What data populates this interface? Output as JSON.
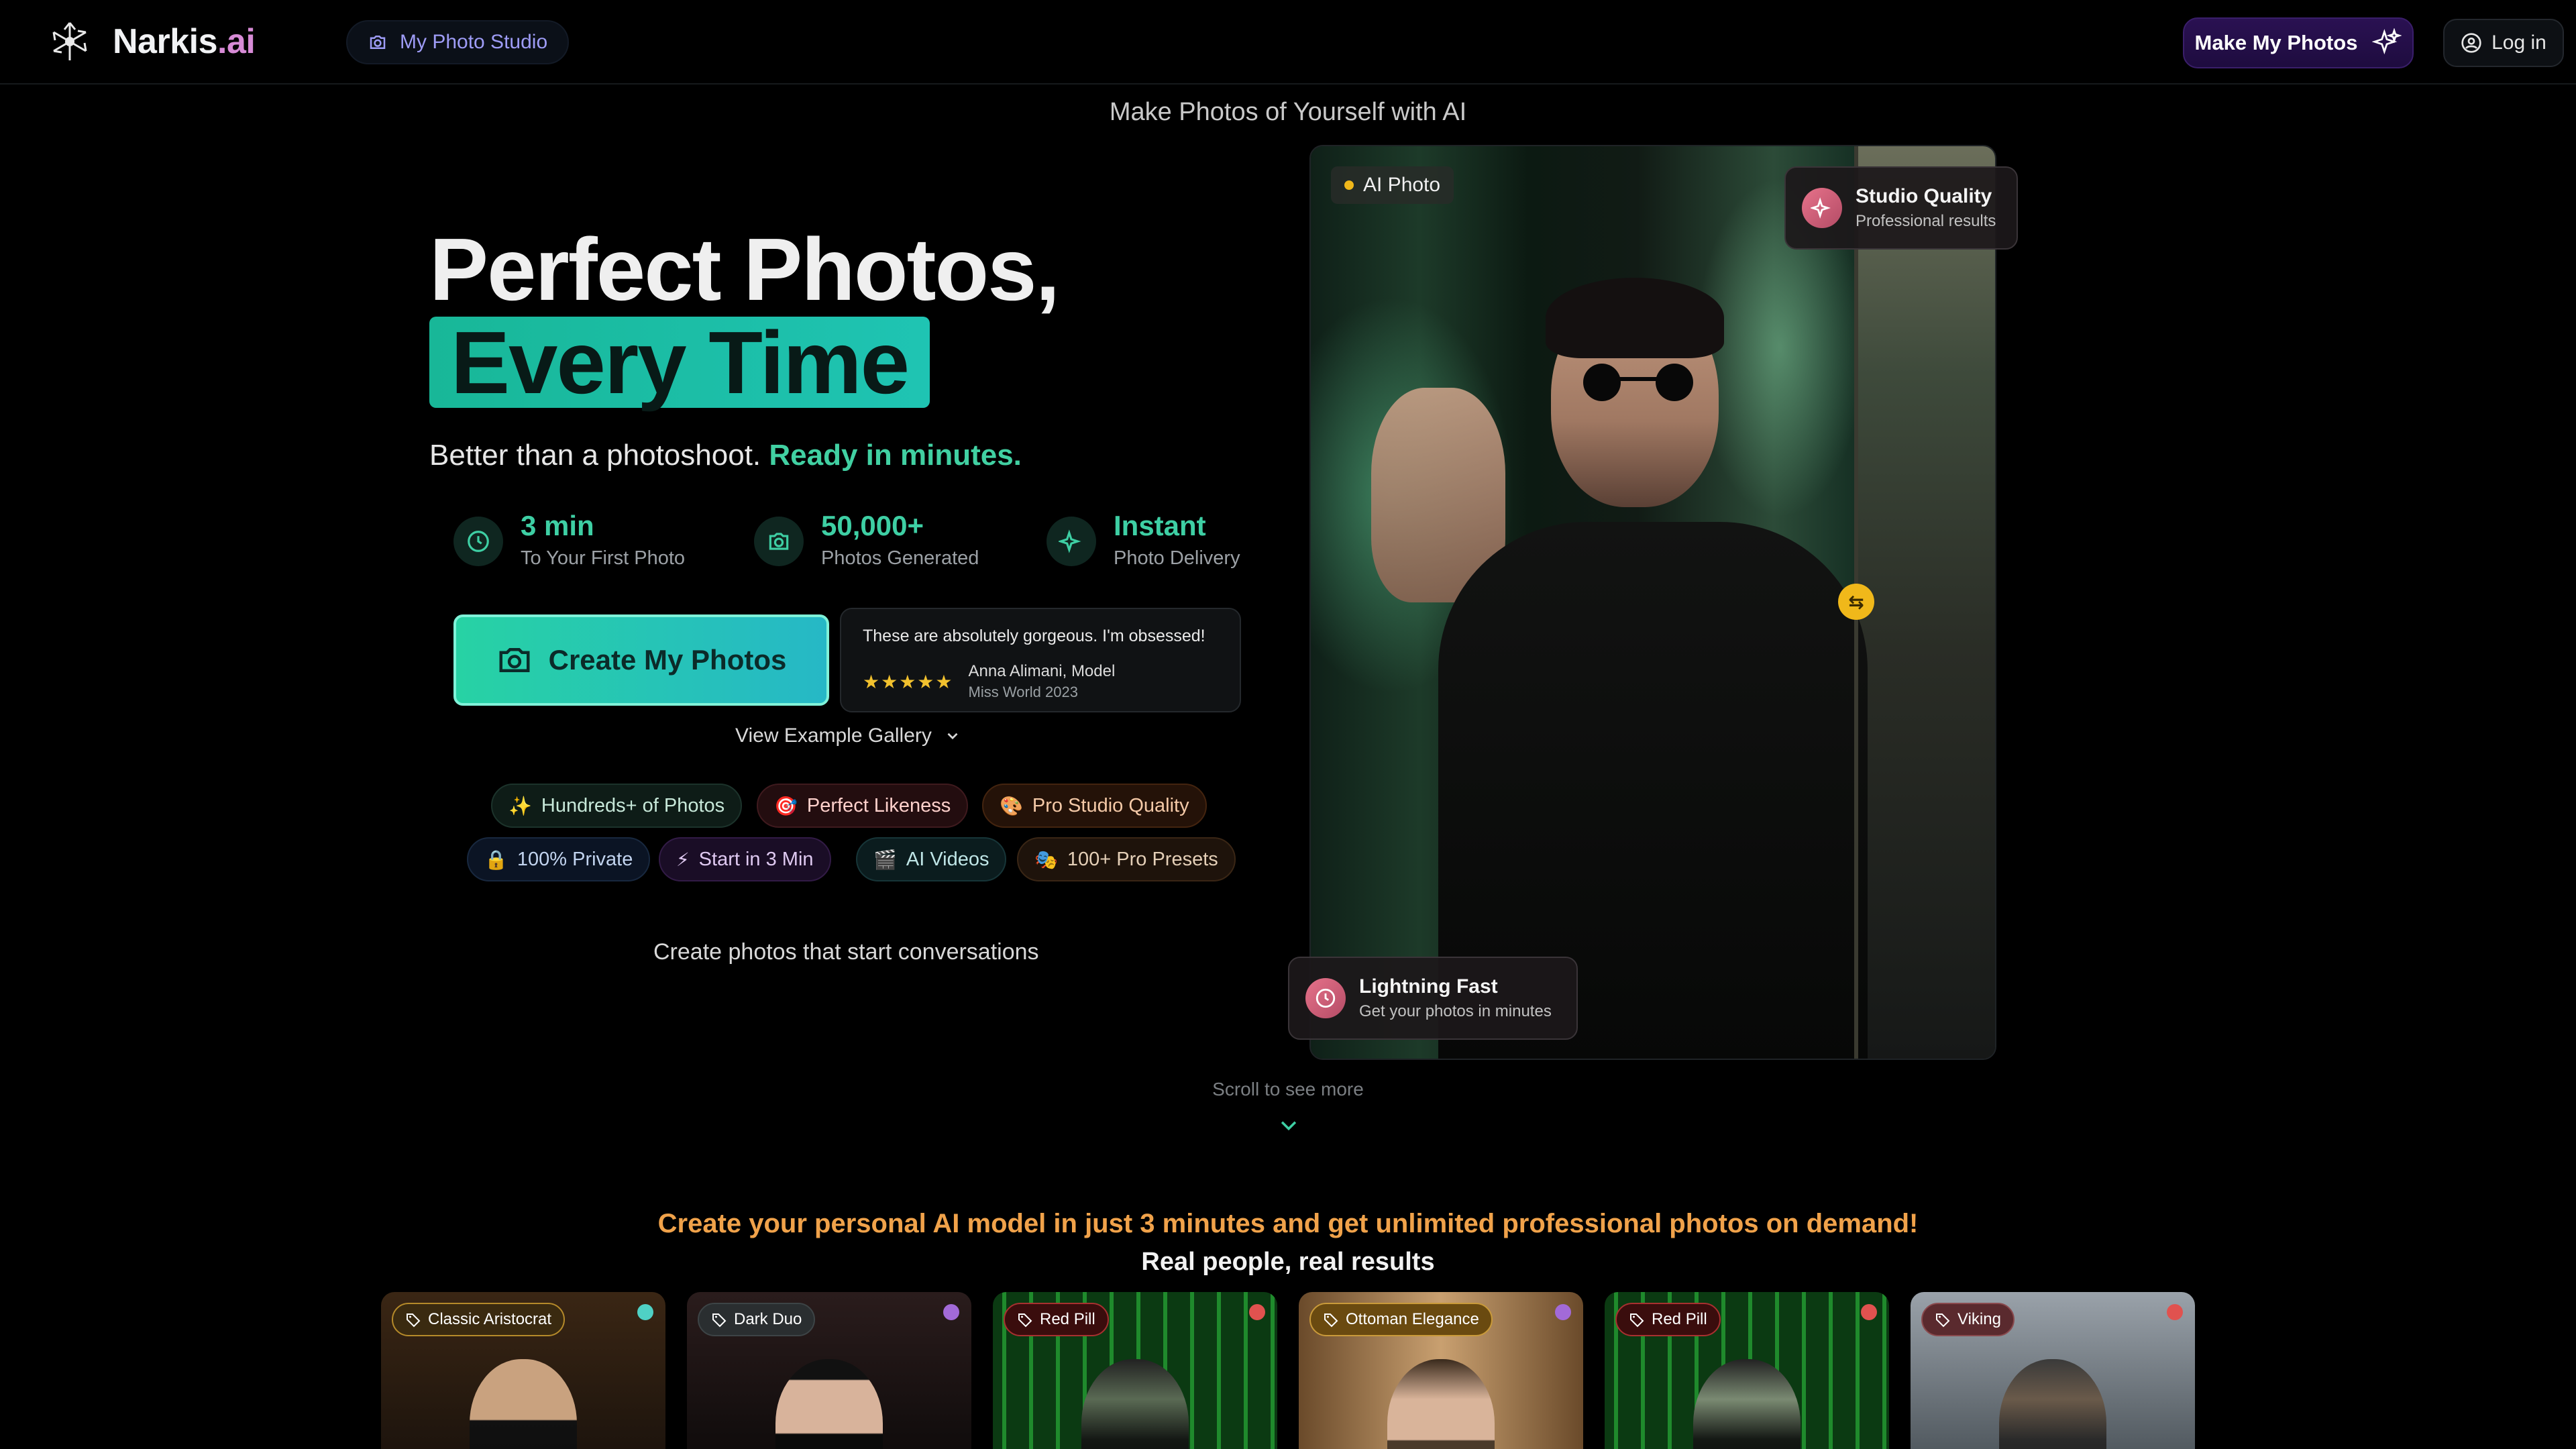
{
  "nav": {
    "brand": "Narkis",
    "brand_suffix": ".ai",
    "studio_label": "My Photo Studio",
    "make_label": "Make My Photos",
    "login_label": "Log in"
  },
  "hero": {
    "subhead": "Make Photos of Yourself with AI",
    "title_line1": "Perfect Photos,",
    "title_line2": "Every Time",
    "tagline_plain": "Better than a photoshoot.",
    "tagline_highlight": "Ready in minutes.",
    "stats": [
      {
        "value": "3 min",
        "label": "To Your First Photo",
        "icon": "clock-icon"
      },
      {
        "value": "50,000+",
        "label": "Photos Generated",
        "icon": "camera-icon"
      },
      {
        "value": "Instant",
        "label": "Photo Delivery",
        "icon": "sparkles-icon"
      }
    ],
    "cta_label": "Create My Photos",
    "review": {
      "quote": "These are absolutely gorgeous. I'm obsessed!",
      "stars": "★★★★★",
      "name": "Anna Alimani, Model",
      "title": "Miss World 2023"
    },
    "gallery_link": "View Example Gallery",
    "chips": [
      {
        "emoji": "✨",
        "label": "Hundreds+ of Photos"
      },
      {
        "emoji": "🎯",
        "label": "Perfect Likeness"
      },
      {
        "emoji": "🎨",
        "label": "Pro Studio Quality"
      },
      {
        "emoji": "🔒",
        "label": "100% Private"
      },
      {
        "emoji": "⚡",
        "label": "Start in 3 Min"
      },
      {
        "emoji": "🎬",
        "label": "AI Videos"
      },
      {
        "emoji": "🎭",
        "label": "100+ Pro Presets"
      }
    ],
    "conversations": "Create photos that start conversations"
  },
  "photo": {
    "tag": "AI Photo",
    "studio_title": "Studio Quality",
    "studio_sub": "Professional results",
    "fast_title": "Lightning Fast",
    "fast_sub": "Get your photos in minutes"
  },
  "scroll_hint": "Scroll to see more",
  "showcase": {
    "promo": "Create your personal AI model in just 3 minutes and get unlimited professional photos on demand!",
    "subtitle": "Real people, real results",
    "cards": [
      {
        "tag": "Classic Aristocrat",
        "dot": "#4fd1c5"
      },
      {
        "tag": "Dark Duo",
        "dot": "#a26ad8"
      },
      {
        "tag": "Red Pill",
        "dot": "#e0524f"
      },
      {
        "tag": "Ottoman Elegance",
        "dot": "#a26ad8"
      },
      {
        "tag": "Red Pill",
        "dot": "#e0524f"
      },
      {
        "tag": "Viking",
        "dot": "#e0524f"
      }
    ]
  }
}
